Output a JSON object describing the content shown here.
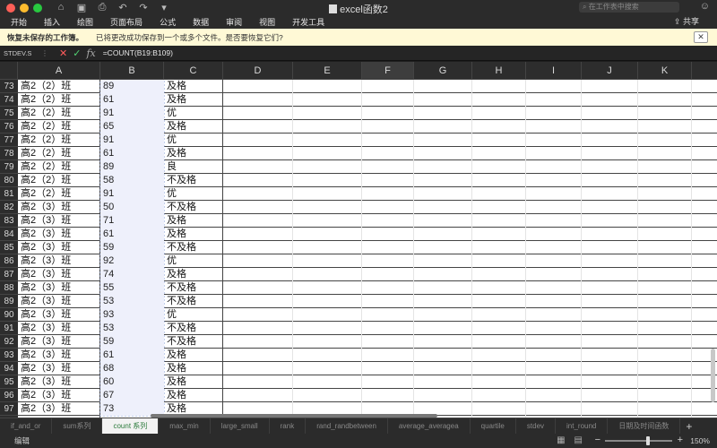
{
  "window": {
    "title": "excel函数2",
    "search_placeholder": "在工作表中搜索",
    "share_label": "共享"
  },
  "ribbon": {
    "tabs": [
      "开始",
      "插入",
      "绘图",
      "页面布局",
      "公式",
      "数据",
      "审阅",
      "视图",
      "开发工具"
    ]
  },
  "message_bar": {
    "title": "恢复未保存的工作簿。",
    "text": "已将更改成功保存到一个或多个文件。是否要恢复它们?"
  },
  "formula_bar": {
    "name_box": "STDEV.S",
    "fx": "fx",
    "formula": "=COUNT(B19:B109)"
  },
  "columns": [
    "A",
    "B",
    "C",
    "D",
    "E",
    "F",
    "G",
    "H",
    "I",
    "J",
    "K"
  ],
  "selected_column": "F",
  "rows": [
    {
      "n": "73",
      "a": "高2（2）班",
      "b": "89",
      "c": "及格"
    },
    {
      "n": "74",
      "a": "高2（2）班",
      "b": "61",
      "c": "及格"
    },
    {
      "n": "75",
      "a": "高2（2）班",
      "b": "91",
      "c": "优"
    },
    {
      "n": "76",
      "a": "高2（2）班",
      "b": "65",
      "c": "及格"
    },
    {
      "n": "77",
      "a": "高2（2）班",
      "b": "91",
      "c": "优"
    },
    {
      "n": "78",
      "a": "高2（2）班",
      "b": "61",
      "c": "及格"
    },
    {
      "n": "79",
      "a": "高2（2）班",
      "b": "89",
      "c": "良"
    },
    {
      "n": "80",
      "a": "高2（2）班",
      "b": "58",
      "c": "不及格"
    },
    {
      "n": "81",
      "a": "高2（2）班",
      "b": "91",
      "c": "优"
    },
    {
      "n": "82",
      "a": "高2（3）班",
      "b": "50",
      "c": "不及格"
    },
    {
      "n": "83",
      "a": "高2（3）班",
      "b": "71",
      "c": "及格"
    },
    {
      "n": "84",
      "a": "高2（3）班",
      "b": "61",
      "c": "及格"
    },
    {
      "n": "85",
      "a": "高2（3）班",
      "b": "59",
      "c": "不及格"
    },
    {
      "n": "86",
      "a": "高2（3）班",
      "b": "92",
      "c": "优"
    },
    {
      "n": "87",
      "a": "高2（3）班",
      "b": "74",
      "c": "及格"
    },
    {
      "n": "88",
      "a": "高2（3）班",
      "b": "55",
      "c": "不及格"
    },
    {
      "n": "89",
      "a": "高2（3）班",
      "b": "53",
      "c": "不及格"
    },
    {
      "n": "90",
      "a": "高2（3）班",
      "b": "93",
      "c": "优"
    },
    {
      "n": "91",
      "a": "高2（3）班",
      "b": "53",
      "c": "不及格"
    },
    {
      "n": "92",
      "a": "高2（3）班",
      "b": "59",
      "c": "不及格"
    },
    {
      "n": "93",
      "a": "高2（3）班",
      "b": "61",
      "c": "及格"
    },
    {
      "n": "94",
      "a": "高2（3）班",
      "b": "68",
      "c": "及格"
    },
    {
      "n": "95",
      "a": "高2（3）班",
      "b": "60",
      "c": "及格"
    },
    {
      "n": "96",
      "a": "高2（3）班",
      "b": "67",
      "c": "及格"
    },
    {
      "n": "97",
      "a": "高2（3）班",
      "b": "73",
      "c": "及格"
    }
  ],
  "sheet_tabs": [
    "if_and_or",
    "sum系列",
    "count 系列",
    "max_min",
    "large_small",
    "rank",
    "rand_randbetween",
    "average_averagea",
    "quartile",
    "stdev",
    "int_round",
    "日期及时间函数"
  ],
  "active_sheet": "count 系列",
  "status": {
    "mode": "编辑",
    "zoom": "150%"
  }
}
